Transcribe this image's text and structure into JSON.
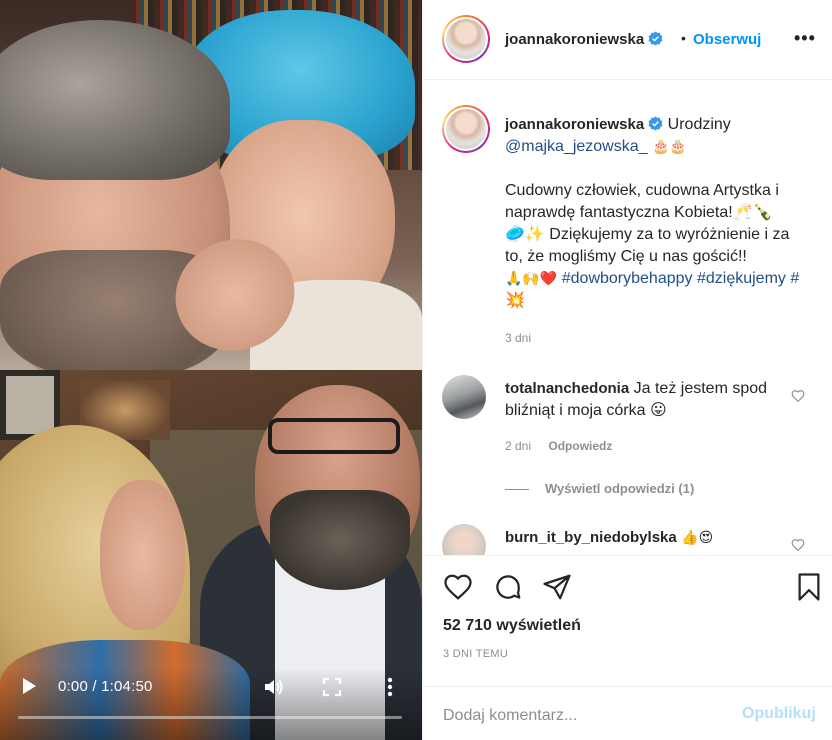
{
  "video": {
    "time": "0:00 / 1:04:50",
    "progress": 0.0
  },
  "header": {
    "username": "joannakoroniewska",
    "dot": "•",
    "follow_label": "Obserwuj",
    "options": "•••"
  },
  "caption": {
    "username": "joannakoroniewska",
    "line1_text": "Urodziny",
    "mention": "@majka_jezowska_",
    "mention_emoji": "🎂🎂",
    "para1": "Cudowny człowiek, cudowna Artystka i naprawdę fantastyczna Kobieta!🥂🍾",
    "para2": "🥏✨ Dziękujemy za to wyróżnienie i za to, że mogliśmy Cię u nas gościć!!",
    "para3_emoji": "🙏🙌❤️",
    "hashtag1": "#dowborybehappy",
    "hashtag2": "#dziękujemy",
    "hashtag3": "#💥",
    "time": "3 dni"
  },
  "comments": [
    {
      "username": "totalnanchedonia",
      "text": "Ja też jestem spod bliźniąt i moja córka 😛",
      "time": "2 dni",
      "reply_label": "Odpowiedz",
      "view_replies": "Wyświetl odpowiedzi (1)"
    },
    {
      "username": "burn_it_by_niedobylska",
      "text": "👍😍"
    }
  ],
  "actions": {
    "views": "52 710 wyświetleń",
    "date": "3 DNI TEMU"
  },
  "add_comment": {
    "placeholder": "Dodaj komentarz...",
    "publish_label": "Opublikuj"
  },
  "colors": {
    "link": "#0095f6",
    "mention": "#1f4f87",
    "muted": "#8e8e8e",
    "publish_disabled": "#b2dffc"
  },
  "icons": [
    "play-icon",
    "volume-icon",
    "fullscreen-icon",
    "more-vertical-icon",
    "verified-icon",
    "more-horizontal-icon",
    "heart-icon",
    "comment-icon",
    "share-icon",
    "bookmark-icon"
  ]
}
